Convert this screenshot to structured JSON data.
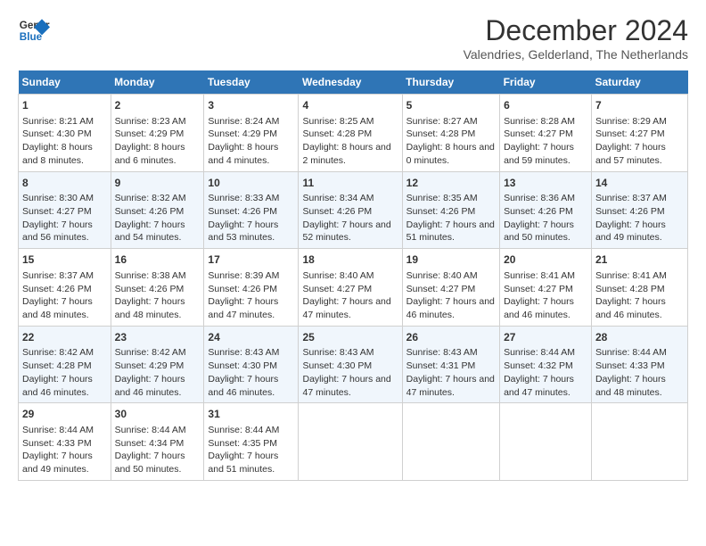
{
  "logo": {
    "line1": "General",
    "line2": "Blue"
  },
  "title": "December 2024",
  "subtitle": "Valendries, Gelderland, The Netherlands",
  "days_header": [
    "Sunday",
    "Monday",
    "Tuesday",
    "Wednesday",
    "Thursday",
    "Friday",
    "Saturday"
  ],
  "weeks": [
    [
      {
        "day": "1",
        "sunrise": "Sunrise: 8:21 AM",
        "sunset": "Sunset: 4:30 PM",
        "daylight": "Daylight: 8 hours and 8 minutes."
      },
      {
        "day": "2",
        "sunrise": "Sunrise: 8:23 AM",
        "sunset": "Sunset: 4:29 PM",
        "daylight": "Daylight: 8 hours and 6 minutes."
      },
      {
        "day": "3",
        "sunrise": "Sunrise: 8:24 AM",
        "sunset": "Sunset: 4:29 PM",
        "daylight": "Daylight: 8 hours and 4 minutes."
      },
      {
        "day": "4",
        "sunrise": "Sunrise: 8:25 AM",
        "sunset": "Sunset: 4:28 PM",
        "daylight": "Daylight: 8 hours and 2 minutes."
      },
      {
        "day": "5",
        "sunrise": "Sunrise: 8:27 AM",
        "sunset": "Sunset: 4:28 PM",
        "daylight": "Daylight: 8 hours and 0 minutes."
      },
      {
        "day": "6",
        "sunrise": "Sunrise: 8:28 AM",
        "sunset": "Sunset: 4:27 PM",
        "daylight": "Daylight: 7 hours and 59 minutes."
      },
      {
        "day": "7",
        "sunrise": "Sunrise: 8:29 AM",
        "sunset": "Sunset: 4:27 PM",
        "daylight": "Daylight: 7 hours and 57 minutes."
      }
    ],
    [
      {
        "day": "8",
        "sunrise": "Sunrise: 8:30 AM",
        "sunset": "Sunset: 4:27 PM",
        "daylight": "Daylight: 7 hours and 56 minutes."
      },
      {
        "day": "9",
        "sunrise": "Sunrise: 8:32 AM",
        "sunset": "Sunset: 4:26 PM",
        "daylight": "Daylight: 7 hours and 54 minutes."
      },
      {
        "day": "10",
        "sunrise": "Sunrise: 8:33 AM",
        "sunset": "Sunset: 4:26 PM",
        "daylight": "Daylight: 7 hours and 53 minutes."
      },
      {
        "day": "11",
        "sunrise": "Sunrise: 8:34 AM",
        "sunset": "Sunset: 4:26 PM",
        "daylight": "Daylight: 7 hours and 52 minutes."
      },
      {
        "day": "12",
        "sunrise": "Sunrise: 8:35 AM",
        "sunset": "Sunset: 4:26 PM",
        "daylight": "Daylight: 7 hours and 51 minutes."
      },
      {
        "day": "13",
        "sunrise": "Sunrise: 8:36 AM",
        "sunset": "Sunset: 4:26 PM",
        "daylight": "Daylight: 7 hours and 50 minutes."
      },
      {
        "day": "14",
        "sunrise": "Sunrise: 8:37 AM",
        "sunset": "Sunset: 4:26 PM",
        "daylight": "Daylight: 7 hours and 49 minutes."
      }
    ],
    [
      {
        "day": "15",
        "sunrise": "Sunrise: 8:37 AM",
        "sunset": "Sunset: 4:26 PM",
        "daylight": "Daylight: 7 hours and 48 minutes."
      },
      {
        "day": "16",
        "sunrise": "Sunrise: 8:38 AM",
        "sunset": "Sunset: 4:26 PM",
        "daylight": "Daylight: 7 hours and 48 minutes."
      },
      {
        "day": "17",
        "sunrise": "Sunrise: 8:39 AM",
        "sunset": "Sunset: 4:26 PM",
        "daylight": "Daylight: 7 hours and 47 minutes."
      },
      {
        "day": "18",
        "sunrise": "Sunrise: 8:40 AM",
        "sunset": "Sunset: 4:27 PM",
        "daylight": "Daylight: 7 hours and 47 minutes."
      },
      {
        "day": "19",
        "sunrise": "Sunrise: 8:40 AM",
        "sunset": "Sunset: 4:27 PM",
        "daylight": "Daylight: 7 hours and 46 minutes."
      },
      {
        "day": "20",
        "sunrise": "Sunrise: 8:41 AM",
        "sunset": "Sunset: 4:27 PM",
        "daylight": "Daylight: 7 hours and 46 minutes."
      },
      {
        "day": "21",
        "sunrise": "Sunrise: 8:41 AM",
        "sunset": "Sunset: 4:28 PM",
        "daylight": "Daylight: 7 hours and 46 minutes."
      }
    ],
    [
      {
        "day": "22",
        "sunrise": "Sunrise: 8:42 AM",
        "sunset": "Sunset: 4:28 PM",
        "daylight": "Daylight: 7 hours and 46 minutes."
      },
      {
        "day": "23",
        "sunrise": "Sunrise: 8:42 AM",
        "sunset": "Sunset: 4:29 PM",
        "daylight": "Daylight: 7 hours and 46 minutes."
      },
      {
        "day": "24",
        "sunrise": "Sunrise: 8:43 AM",
        "sunset": "Sunset: 4:30 PM",
        "daylight": "Daylight: 7 hours and 46 minutes."
      },
      {
        "day": "25",
        "sunrise": "Sunrise: 8:43 AM",
        "sunset": "Sunset: 4:30 PM",
        "daylight": "Daylight: 7 hours and 47 minutes."
      },
      {
        "day": "26",
        "sunrise": "Sunrise: 8:43 AM",
        "sunset": "Sunset: 4:31 PM",
        "daylight": "Daylight: 7 hours and 47 minutes."
      },
      {
        "day": "27",
        "sunrise": "Sunrise: 8:44 AM",
        "sunset": "Sunset: 4:32 PM",
        "daylight": "Daylight: 7 hours and 47 minutes."
      },
      {
        "day": "28",
        "sunrise": "Sunrise: 8:44 AM",
        "sunset": "Sunset: 4:33 PM",
        "daylight": "Daylight: 7 hours and 48 minutes."
      }
    ],
    [
      {
        "day": "29",
        "sunrise": "Sunrise: 8:44 AM",
        "sunset": "Sunset: 4:33 PM",
        "daylight": "Daylight: 7 hours and 49 minutes."
      },
      {
        "day": "30",
        "sunrise": "Sunrise: 8:44 AM",
        "sunset": "Sunset: 4:34 PM",
        "daylight": "Daylight: 7 hours and 50 minutes."
      },
      {
        "day": "31",
        "sunrise": "Sunrise: 8:44 AM",
        "sunset": "Sunset: 4:35 PM",
        "daylight": "Daylight: 7 hours and 51 minutes."
      },
      null,
      null,
      null,
      null
    ]
  ]
}
